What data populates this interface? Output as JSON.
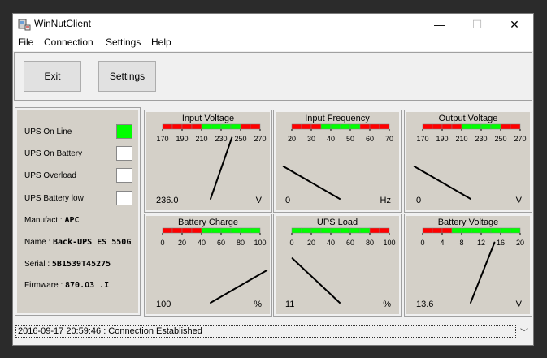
{
  "window": {
    "title": "WinNutClient",
    "controls": {
      "minimize": "—",
      "maximize": "☐",
      "close": "✕"
    }
  },
  "menu": [
    "File",
    "Connection",
    "Settings",
    "Help"
  ],
  "toolbar": {
    "exit_label": "Exit",
    "settings_label": "Settings"
  },
  "status": {
    "indicators": [
      {
        "label": "UPS On Line",
        "active": true
      },
      {
        "label": "UPS On Battery",
        "active": false
      },
      {
        "label": "UPS Overload",
        "active": false
      },
      {
        "label": "UPS Battery low",
        "active": false
      }
    ],
    "manufacturer_label": "Manufact :",
    "manufacturer": "APC",
    "name_label": "Name :",
    "name": "Back-UPS ES 550G",
    "serial_label": "Serial :",
    "serial": "5B1539T45275",
    "firmware_label": "Firmware :",
    "firmware": "870.O3 .I"
  },
  "colors": {
    "active": "#00ff00",
    "inactive": "#ffffff",
    "scale_red": "#ff0000",
    "scale_green": "#00ff00"
  },
  "gauges": [
    {
      "title": "Input Voltage",
      "ticks": [
        "170",
        "190",
        "210",
        "230",
        "250",
        "270"
      ],
      "min": 170,
      "max": 270,
      "zones": [
        [
          170,
          205,
          "red"
        ],
        [
          205,
          245,
          "green"
        ],
        [
          245,
          270,
          "red"
        ]
      ],
      "value": 236.0,
      "value_text": "236.0",
      "unit": "V"
    },
    {
      "title": "Input Frequency",
      "ticks": [
        "20",
        "30",
        "40",
        "50",
        "60",
        "70"
      ],
      "min": 20,
      "max": 70,
      "zones": [
        [
          20,
          35,
          "red"
        ],
        [
          35,
          55,
          "green"
        ],
        [
          55,
          70,
          "red"
        ]
      ],
      "value": 0,
      "value_text": "0",
      "unit": "Hz"
    },
    {
      "title": "Output Voltage",
      "ticks": [
        "170",
        "190",
        "210",
        "230",
        "250",
        "270"
      ],
      "min": 170,
      "max": 270,
      "zones": [
        [
          170,
          205,
          "red"
        ],
        [
          205,
          245,
          "green"
        ],
        [
          245,
          270,
          "red"
        ]
      ],
      "value": 0,
      "value_text": "0",
      "unit": "V"
    },
    {
      "title": "Battery Charge",
      "ticks": [
        "0",
        "20",
        "40",
        "60",
        "80",
        "100"
      ],
      "min": 0,
      "max": 100,
      "zones": [
        [
          0,
          40,
          "red"
        ],
        [
          40,
          100,
          "green"
        ]
      ],
      "value": 100,
      "value_text": "100",
      "unit": "%"
    },
    {
      "title": "UPS Load",
      "ticks": [
        "0",
        "20",
        "40",
        "60",
        "80",
        "100"
      ],
      "min": 0,
      "max": 100,
      "zones": [
        [
          0,
          80,
          "green"
        ],
        [
          80,
          100,
          "red"
        ]
      ],
      "value": 11,
      "value_text": "11",
      "unit": "%"
    },
    {
      "title": "Battery Voltage",
      "ticks": [
        "0",
        "4",
        "8",
        "12",
        "16",
        "20"
      ],
      "min": 0,
      "max": 20,
      "zones": [
        [
          0,
          6,
          "red"
        ],
        [
          6,
          20,
          "green"
        ]
      ],
      "value": 13.6,
      "value_text": "13.6",
      "unit": "V"
    }
  ],
  "statusbar": {
    "message": "2016-09-17 20:59:46 : Connection Established"
  }
}
